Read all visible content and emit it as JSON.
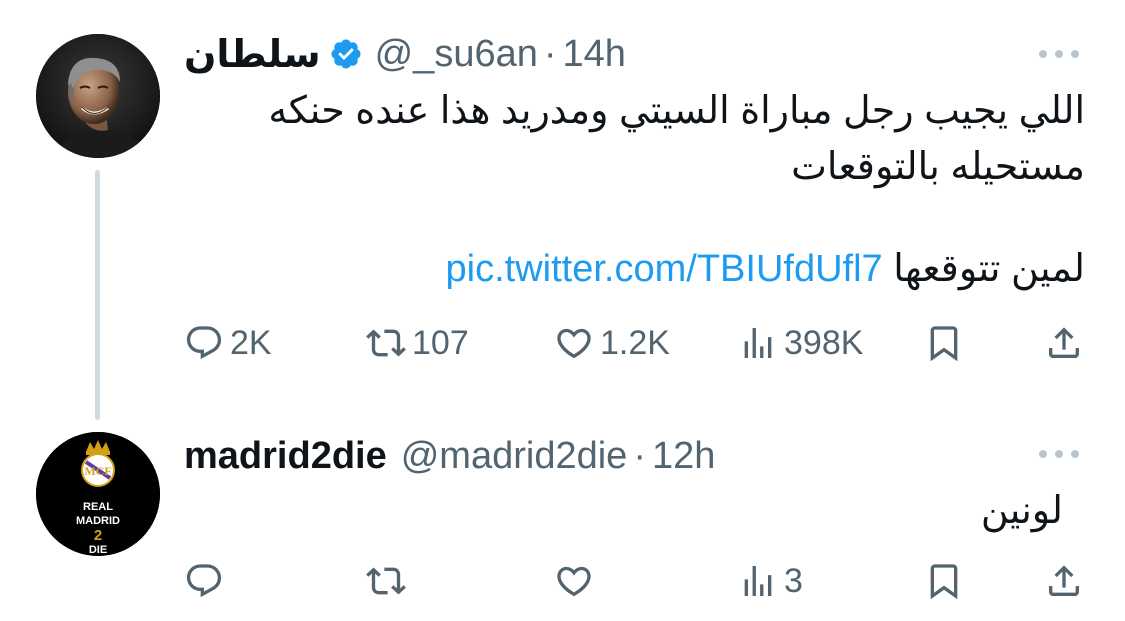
{
  "tweets": [
    {
      "display_name": "سلطان",
      "verified": true,
      "handle": "@_su6an",
      "dot": "·",
      "time": "14h",
      "text_line1": "اللي يجيب رجل مباراة السيتي ومدريد هذا عنده حنكه",
      "text_line2": "مستحيله بالتوقعات",
      "text_line3_prefix": "لمين تتوقعها",
      "link": "pic.twitter.com/TBIUfdUfl7",
      "actions": {
        "reply_count": "2K",
        "retweet_count": "107",
        "like_count": "1.2K",
        "views_count": "398K"
      },
      "avatar": "portrait-photo"
    },
    {
      "display_name": "madrid2die",
      "verified": false,
      "handle": "@madrid2die",
      "dot": "·",
      "time": "12h",
      "text_line1": "لونين",
      "actions": {
        "reply_count": "",
        "retweet_count": "",
        "like_count": "",
        "views_count": "3"
      },
      "avatar": {
        "line1": "REAL",
        "line2": "MADRID",
        "line3": "2",
        "line4": "DIE"
      }
    }
  ],
  "colors": {
    "text": "#0f1419",
    "muted": "#536471",
    "link": "#1d9bf0",
    "verified": "#1d9bf0",
    "thread_line": "#cfd9de",
    "logo_accent": "#d4a017"
  },
  "icons": [
    "reply-icon",
    "retweet-icon",
    "like-icon",
    "views-icon",
    "bookmark-icon",
    "share-icon",
    "verified-badge-icon",
    "more-icon"
  ]
}
